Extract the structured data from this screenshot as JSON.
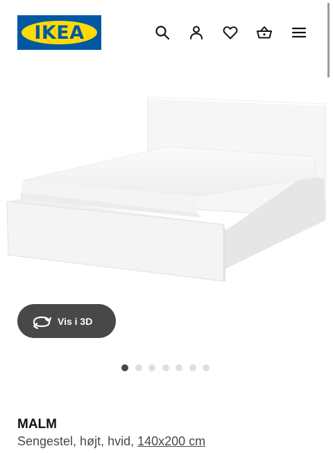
{
  "header": {
    "logo_text": "IKEA",
    "icons": [
      "search-icon",
      "account-icon",
      "heart-icon",
      "basket-icon",
      "menu-icon"
    ]
  },
  "colors": {
    "brand_blue": "#0058a3",
    "brand_yellow": "#ffdb00",
    "button_dark": "#484848",
    "dot_inactive": "#dfdfdf"
  },
  "gallery": {
    "view_3d_label": "Vis i 3D",
    "slide_count": 7,
    "active_slide": 1
  },
  "product": {
    "name": "MALM",
    "description": "Sengestel, højt, hvid, ",
    "size_link": "140x200 cm"
  }
}
